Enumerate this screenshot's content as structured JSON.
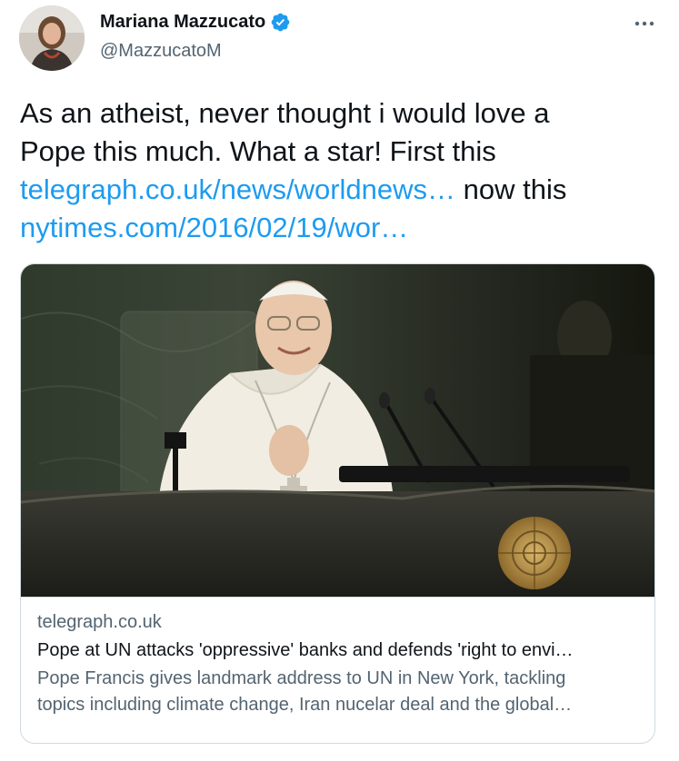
{
  "author": {
    "display_name": "Mariana Mazzucato",
    "handle": "@MazzucatoM",
    "verified": true
  },
  "tweet": {
    "line1": "As an atheist, never thought i would love a",
    "line2": "Pope this much. What a star! First this",
    "link1": "telegraph.co.uk/news/worldnews…",
    "mid_text": " now this",
    "link2": "nytimes.com/2016/02/19/wor…"
  },
  "card": {
    "domain": "telegraph.co.uk",
    "title": "Pope at UN attacks 'oppressive' banks and defends 'right to envi…",
    "description_line1": "Pope Francis gives landmark address to UN in New York, tackling",
    "description_line2": "topics including climate change, Iran nucelar deal and the global…"
  },
  "colors": {
    "link": "#1d9bf0",
    "secondary_text": "#536471",
    "primary_text": "#0f1419",
    "border": "#cfd9de"
  },
  "icons": {
    "verified": "verified-badge-icon",
    "more": "more-options-icon"
  }
}
